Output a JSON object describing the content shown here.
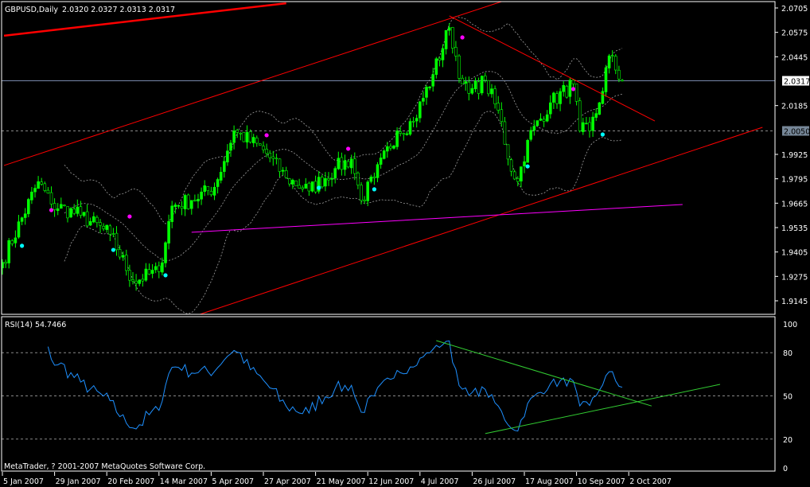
{
  "header": {
    "symbol_label": "GBPUSD,Daily",
    "ohlc": "2.0320 2.0327 2.0313 2.0317"
  },
  "rsi_header": "RSI(14) 54.7466",
  "copyright": "MetaTrader, ? 2001-2007 MetaQuotes Software Corp.",
  "colors": {
    "candle": "#00ff00",
    "trend": "#ff0000",
    "support": "#ff00ff",
    "rsi": "#1e90ff",
    "rsi_trend": "#32cd32",
    "bands": "#a0a0a0",
    "fractal_up": "#ff00ff",
    "fractal_down": "#00ffff"
  },
  "chart_data": [
    {
      "type": "candlestick",
      "title": "GBPUSD,Daily",
      "ylim": [
        1.9145,
        2.0705
      ],
      "y_ticks": [
        "2.0705",
        "2.0575",
        "2.0445",
        "2.0185",
        "1.9925",
        "1.9795",
        "1.9665",
        "1.9535",
        "1.9405",
        "1.9275",
        "1.9145"
      ],
      "current_price": "2.0317",
      "level_line": "2.0050",
      "x_ticks": [
        {
          "bar": 0,
          "label": "5 Jan 2007"
        },
        {
          "bar": 16,
          "label": "29 Jan 2007"
        },
        {
          "bar": 32,
          "label": "20 Feb 2007"
        },
        {
          "bar": 48,
          "label": "14 Mar 2007"
        },
        {
          "bar": 64,
          "label": "5 Apr 2007"
        },
        {
          "bar": 80,
          "label": "27 Apr 2007"
        },
        {
          "bar": 96,
          "label": "21 May 2007"
        },
        {
          "bar": 112,
          "label": "12 Jun 2007"
        },
        {
          "bar": 128,
          "label": "4 Jul 2007"
        },
        {
          "bar": 144,
          "label": "26 Jul 2007"
        },
        {
          "bar": 160,
          "label": "17 Aug 2007"
        },
        {
          "bar": 176,
          "label": "10 Sep 2007"
        },
        {
          "bar": 192,
          "label": "2 Oct 2007"
        }
      ],
      "bar_count": 191,
      "close_anchors": [
        [
          0,
          1.935
        ],
        [
          11,
          1.978
        ],
        [
          15,
          1.966
        ],
        [
          24,
          1.96
        ],
        [
          33,
          1.95
        ],
        [
          40,
          1.925
        ],
        [
          48,
          1.93
        ],
        [
          52,
          1.965
        ],
        [
          58,
          1.968
        ],
        [
          65,
          1.975
        ],
        [
          71,
          2.005
        ],
        [
          80,
          1.995
        ],
        [
          87,
          1.98
        ],
        [
          94,
          1.973
        ],
        [
          102,
          1.985
        ],
        [
          107,
          1.99
        ],
        [
          110,
          1.968
        ],
        [
          114,
          1.98
        ],
        [
          121,
          2.005
        ],
        [
          126,
          2.01
        ],
        [
          132,
          2.035
        ],
        [
          137,
          2.06
        ],
        [
          141,
          2.03
        ],
        [
          143,
          2.025
        ],
        [
          148,
          2.032
        ],
        [
          153,
          2.01
        ],
        [
          155,
          1.99
        ],
        [
          158,
          1.978
        ],
        [
          161,
          2.0
        ],
        [
          168,
          2.02
        ],
        [
          175,
          2.03
        ],
        [
          177,
          2.005
        ],
        [
          180,
          2.005
        ],
        [
          183,
          2.02
        ],
        [
          186,
          2.045
        ],
        [
          190,
          2.0317
        ]
      ],
      "bollinger": {
        "period": 20,
        "deviation": 2
      },
      "trendlines": [
        {
          "name": "upper-channel",
          "color": "trend",
          "from": [
            0.5,
            1.9866
          ],
          "to": [
            153,
            2.0739
          ]
        },
        {
          "name": "lower-channel",
          "color": "trend",
          "from": [
            59,
            1.9064
          ],
          "to": [
            233,
            2.0069
          ]
        },
        {
          "name": "old-channel",
          "color": "trend",
          "from": [
            0.5,
            2.0557
          ],
          "to": [
            87,
            2.073
          ]
        },
        {
          "name": "downtrend",
          "color": "trend",
          "from": [
            137,
            2.0663
          ],
          "to": [
            200,
            2.0103
          ]
        },
        {
          "name": "support",
          "color": "support",
          "from": [
            58,
            1.951
          ],
          "to": [
            208.5,
            1.9658
          ]
        }
      ],
      "fractals_up": [
        [
          15,
          1.9628
        ],
        [
          39,
          1.9594
        ],
        [
          81,
          2.0027
        ],
        [
          106,
          1.9955
        ],
        [
          141,
          2.0548
        ],
        [
          175,
          2.0273
        ]
      ],
      "fractals_down": [
        [
          6,
          1.9438
        ],
        [
          34,
          1.9416
        ],
        [
          50,
          1.9281
        ],
        [
          97,
          1.9747
        ],
        [
          114,
          1.9739
        ],
        [
          161,
          1.9861
        ],
        [
          184,
          2.0031
        ]
      ]
    },
    {
      "type": "line",
      "title": "RSI(14)",
      "last_value": "54.7466",
      "ylim": [
        0,
        100
      ],
      "y_ticks": [
        "100",
        "80",
        "50",
        "20",
        "0"
      ],
      "trendlines": [
        {
          "name": "rsi-resistance",
          "from": [
            133,
            88.4
          ],
          "to": [
            199,
            43
          ]
        },
        {
          "name": "rsi-support",
          "from": [
            148,
            23.8
          ],
          "to": [
            220,
            58
          ]
        }
      ]
    }
  ]
}
